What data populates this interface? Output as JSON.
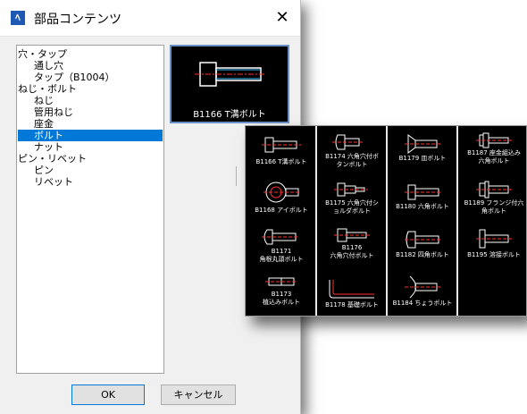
{
  "dialog": {
    "title": "部品コンテンツ",
    "close_glyph": "✕",
    "app_icon_glyph": "ﾍ",
    "ok_label": "OK",
    "cancel_label": "キャンセル"
  },
  "tree": [
    {
      "label": "穴・タップ",
      "level": 0,
      "selected": false
    },
    {
      "label": "通し穴",
      "level": 1,
      "selected": false
    },
    {
      "label": "タップ（B1004）",
      "level": 1,
      "selected": false
    },
    {
      "label": "ねじ・ボルト",
      "level": 0,
      "selected": false
    },
    {
      "label": "ねじ",
      "level": 1,
      "selected": false
    },
    {
      "label": "管用ねじ",
      "level": 1,
      "selected": false
    },
    {
      "label": "座金",
      "level": 1,
      "selected": false
    },
    {
      "label": "ボルト",
      "level": 1,
      "selected": true
    },
    {
      "label": "ナット",
      "level": 1,
      "selected": false
    },
    {
      "label": "ピン・リベット",
      "level": 0,
      "selected": false
    },
    {
      "label": "ピン",
      "level": 1,
      "selected": false
    },
    {
      "label": "リベット",
      "level": 1,
      "selected": false
    }
  ],
  "preview": {
    "label": "B1166 T溝ボルト",
    "icon": "t-slot-bolt-icon"
  },
  "palette": {
    "columns": [
      [
        {
          "label": "B1166 T溝ボルト",
          "icon": "t-slot-bolt-icon"
        },
        {
          "label": "B1168 アイボルト",
          "icon": "eye-bolt-icon"
        },
        {
          "label": "B1171\n角根丸頭ボルト",
          "icon": "carriage-bolt-icon"
        },
        {
          "label": "B1173\n植込みボルト",
          "icon": "stud-bolt-icon"
        }
      ],
      [
        {
          "label": "B1174 六角穴付ボ\nタンボルト",
          "icon": "button-head-bolt-icon"
        },
        {
          "label": "B1175 六角穴付シ\nョルダボルト",
          "icon": "shoulder-bolt-icon"
        },
        {
          "label": "B1176\n六角穴付ボルト",
          "icon": "socket-head-bolt-icon"
        },
        {
          "label": "B1178 基礎ボルト",
          "icon": "foundation-bolt-icon"
        }
      ],
      [
        {
          "label": "B1179 皿ボルト",
          "icon": "countersunk-bolt-icon"
        },
        {
          "label": "B1180 六角ボルト",
          "icon": "hex-bolt-icon"
        },
        {
          "label": "B1182 四角ボルト",
          "icon": "square-bolt-icon"
        },
        {
          "label": "B1184 ちょうボルト",
          "icon": "wing-bolt-icon"
        }
      ],
      [
        {
          "label": "B1187 座金組込み\n六角ボルト",
          "icon": "washer-hex-bolt-icon"
        },
        {
          "label": "B1189 フランジ付六\n角ボルト",
          "icon": "flange-bolt-icon"
        },
        {
          "label": "B1195 溶接ボルト",
          "icon": "weld-bolt-icon"
        }
      ]
    ]
  },
  "colors": {
    "selection": "#0078d7",
    "palette_bg": "#000000",
    "drawing_line": "#ffffff",
    "center_line": "#ff3030",
    "thread_line": "#40c0ff"
  }
}
